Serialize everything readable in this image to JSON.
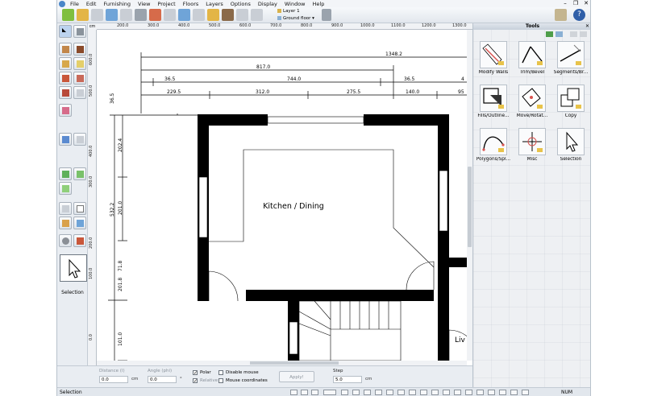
{
  "menu": [
    "File",
    "Edit",
    "Furnishing",
    "View",
    "Project",
    "Floors",
    "Layers",
    "Options",
    "Display",
    "Window",
    "Help"
  ],
  "window_controls": {
    "minimize": "–",
    "restore": "❐",
    "close": "✕"
  },
  "toolbar": {
    "layer": "Layer 1",
    "floor": "Ground floor"
  },
  "ruler": {
    "unit": "cm",
    "top": [
      "200.0",
      "300.0",
      "400.0",
      "500.0",
      "600.0",
      "700.0",
      "800.0",
      "900.0",
      "1000.0",
      "1100.0",
      "1200.0",
      "1300.0"
    ],
    "left": [
      "600.0",
      "500.0",
      "400.0",
      "300.0",
      "200.0",
      "100.0",
      "0.0"
    ]
  },
  "plan": {
    "room_label": "Kitchen / Dining",
    "room_label_right": "Liv",
    "dims_top": {
      "overall": "1348.2",
      "row2": "817.0",
      "row3_a": "36.5",
      "row3_b": "744.0",
      "row3_c": "36.5",
      "row3_d": "4",
      "row4_a": "229.5",
      "row4_b": "312.0",
      "row4_c": "275.5",
      "row4_d": "140.0",
      "row4_e": "95"
    },
    "dims_left": {
      "a": "36.5",
      "b": "202.4",
      "c": "201.0",
      "d": "532.2",
      "e": "71.8",
      "f": "201.8",
      "g": "101.0"
    }
  },
  "palette": {
    "selection_label": "Selection"
  },
  "tools_panel": {
    "title": "Tools",
    "items": [
      {
        "label": "Modify Walls",
        "icon": "modify-walls-icon"
      },
      {
        "label": "Trim/Bevel",
        "icon": "trim-bevel-icon"
      },
      {
        "label": "Segments/Br...",
        "icon": "segments-icon"
      },
      {
        "label": "Fills/Outline...",
        "icon": "fills-outline-icon"
      },
      {
        "label": "Move/Rotat...",
        "icon": "move-rotate-icon"
      },
      {
        "label": "Copy",
        "icon": "copy-icon"
      },
      {
        "label": "Polygons/Spl...",
        "icon": "polygons-spline-icon"
      },
      {
        "label": "Misc",
        "icon": "misc-icon"
      },
      {
        "label": "Selection",
        "icon": "selection-arrow-icon"
      }
    ]
  },
  "input_bar": {
    "distance_label": "Distance (l)",
    "distance_value": "0.0",
    "distance_unit": "cm",
    "angle_label": "Angle (phi)",
    "angle_value": "0.0",
    "angle_unit": "°",
    "polar_label": "Polar",
    "relative_label": "Relative",
    "disable_mouse_label": "Disable mouse",
    "mouse_coords_label": "Mouse coordinates",
    "apply_label": "Apply!",
    "step_label": "Step",
    "step_value": "5.0",
    "step_unit": "cm"
  },
  "status": {
    "text": "Selection",
    "num": "NUM"
  },
  "colors": {
    "wall": "#000000",
    "accent": "#4a86c8",
    "panel": "#eaeef3"
  }
}
